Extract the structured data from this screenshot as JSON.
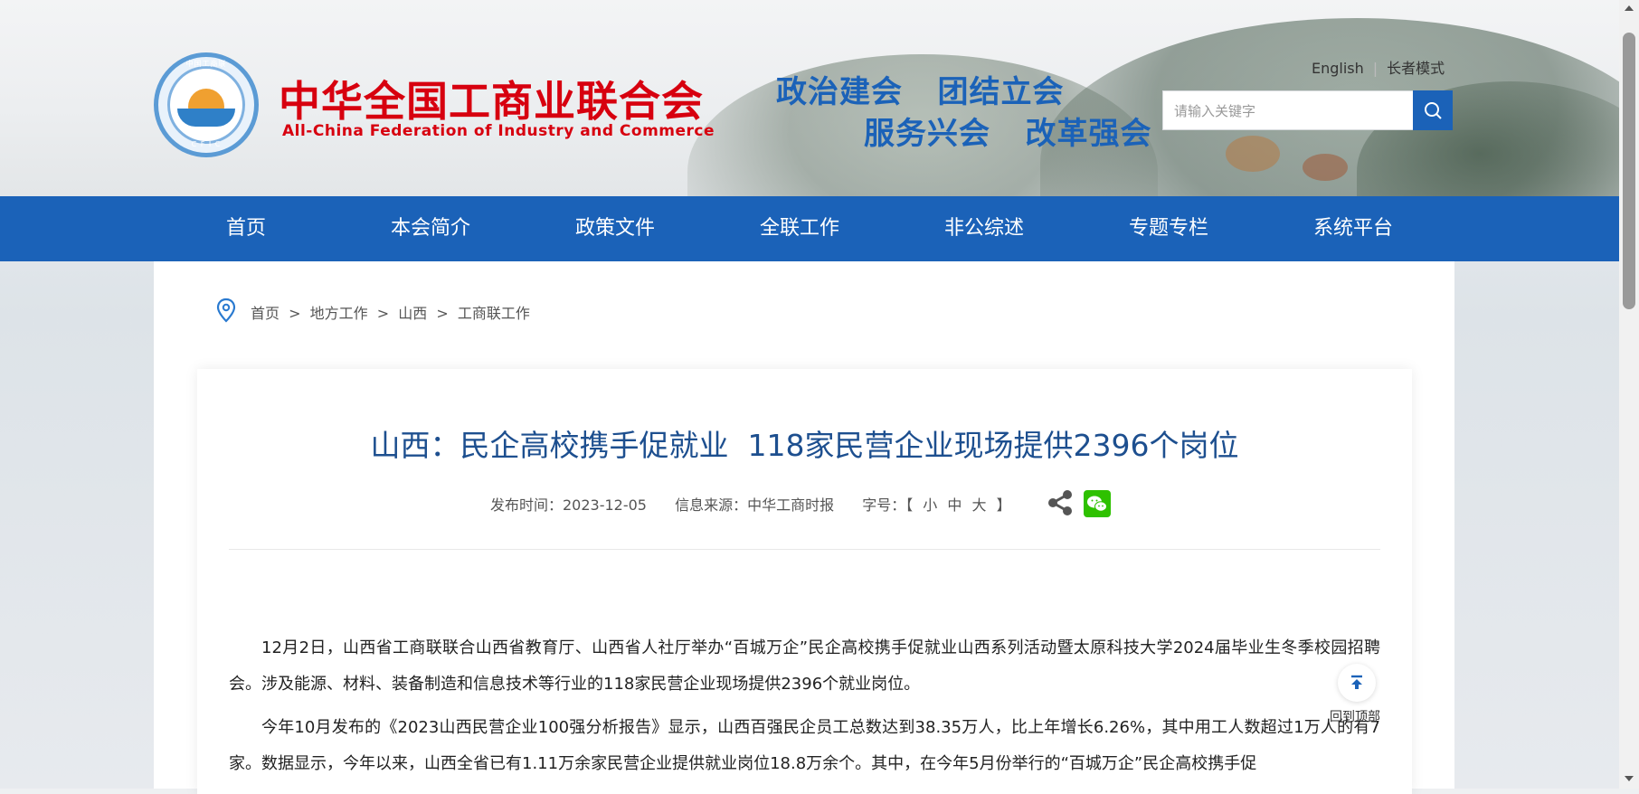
{
  "header": {
    "logo_cn": "中华全国工商业联合会",
    "logo_en": "All-China Federation of Industry and Commerce",
    "logo_ring_top": "中国工商联",
    "logo_ring_bottom": "C F I C",
    "slogan_line1": "政治建会   团结立会",
    "slogan_line2": "服务兴会   改革强会",
    "links": {
      "english": "English",
      "elderly": "长者模式"
    },
    "search": {
      "placeholder": "请输入关键字"
    }
  },
  "nav": {
    "items": [
      "首页",
      "本会简介",
      "政策文件",
      "全联工作",
      "非公综述",
      "专题专栏",
      "系统平台"
    ]
  },
  "breadcrumb": [
    "首页",
    "地方工作",
    "山西",
    "工商联工作"
  ],
  "article": {
    "title": "山西：民企高校携手促就业  118家民营企业现场提供2396个岗位",
    "publish_label": "发布时间：2023-12-05",
    "source_label": "信息来源：中华工商时报",
    "font_label": "字号：",
    "font_sizes": "【 小 中 大 】",
    "paragraph1": "12月2日，山西省工商联联合山西省教育厅、山西省人社厅举办“百城万企”民企高校携手促就业山西系列活动暨太原科技大学2024届毕业生冬季校园招聘会。涉及能源、材料、装备制造和信息技术等行业的118家民营企业现场提供2396个就业岗位。",
    "paragraph2": "今年10月发布的《2023山西民营企业100强分析报告》显示，山西百强民企员工总数达到38.35万人，比上年增长6.26%，其中用工人数超过1万人的有7家。数据显示，今年以来，山西全省已有1.11万余家民营企业提供就业岗位18.8万余个。其中，在今年5月份举行的“百城万企”民企高校携手促"
  },
  "back_to_top": "回到顶部",
  "colors": {
    "brand_blue": "#1b62b8",
    "logo_red": "#d7000f",
    "title_blue": "#1d4f8f",
    "wechat_green": "#2ec100"
  }
}
